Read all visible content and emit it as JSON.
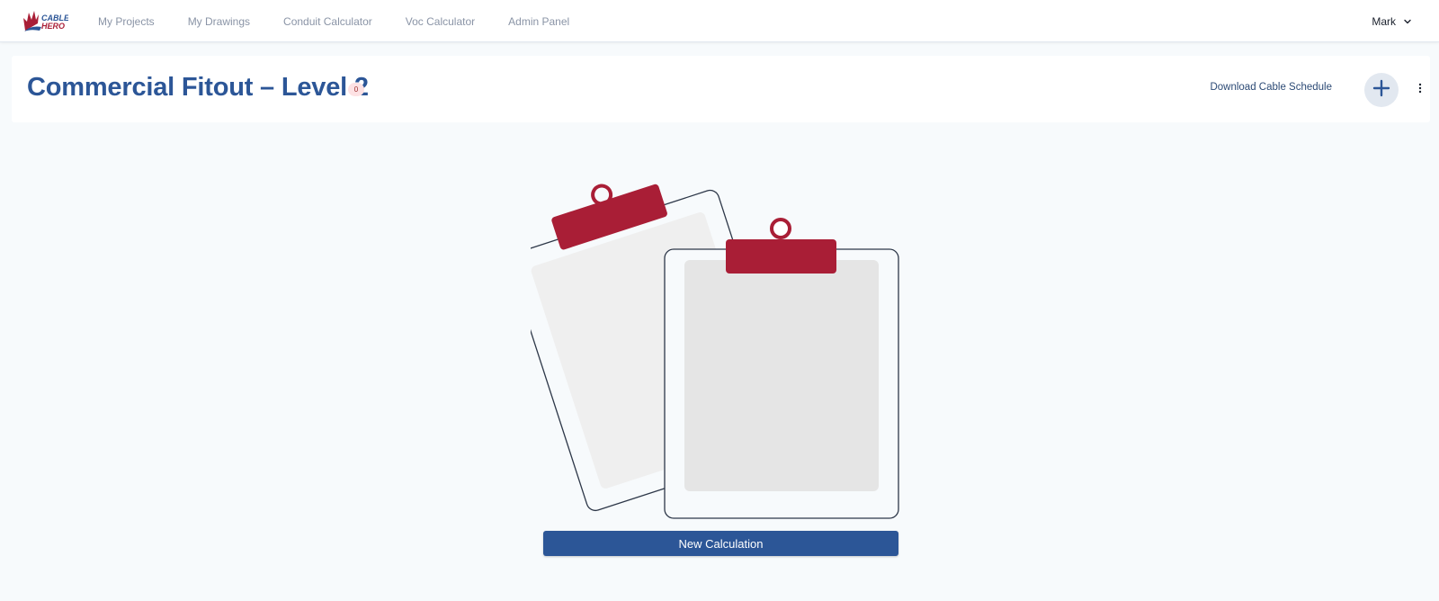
{
  "app": {
    "logo_text_line1": "CABLE",
    "logo_text_line2": "HERO"
  },
  "nav": {
    "items": [
      {
        "label": "My Projects"
      },
      {
        "label": "My Drawings"
      },
      {
        "label": "Conduit Calculator"
      },
      {
        "label": "Voc Calculator"
      },
      {
        "label": "Admin Panel"
      }
    ]
  },
  "user": {
    "name": "Mark",
    "menu_icon": "chevron-down-icon"
  },
  "header": {
    "title": "Commercial Fitout – Level 2",
    "count_badge": "0",
    "download_label": "Download Cable Schedule",
    "add_icon": "plus-icon",
    "more_icon": "more-vertical-icon"
  },
  "empty_state": {
    "illustration": "clipboards-illustration",
    "button_label": "New Calculation"
  },
  "colors": {
    "brand_blue": "#2c5697",
    "brand_red": "#a91e36",
    "background": "#f7fafc",
    "nav_text": "#8a94a6"
  }
}
